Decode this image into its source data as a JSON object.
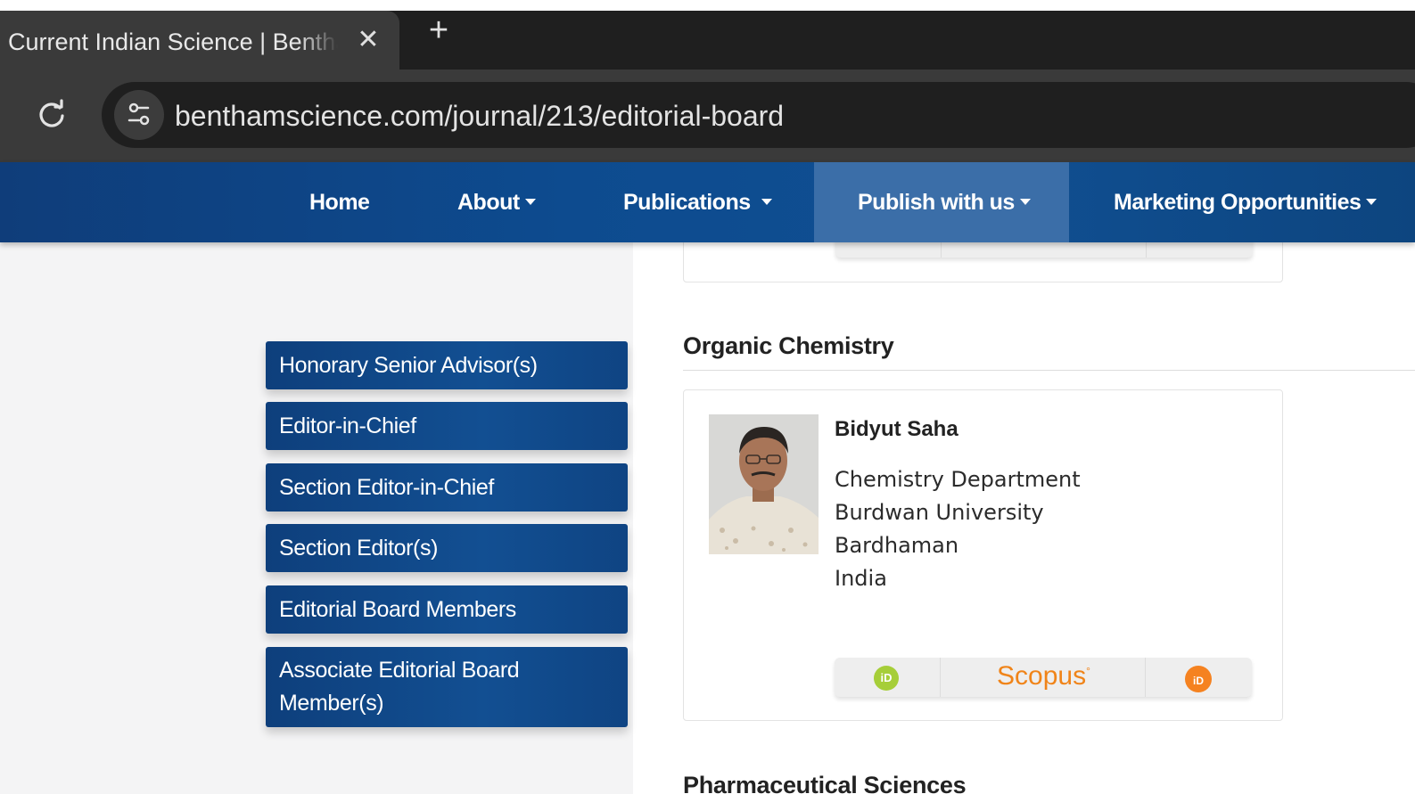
{
  "browser": {
    "tab_title": "Current Indian Science | Bentham Science",
    "close_glyph": "✕",
    "new_tab_glyph": "+",
    "url": "benthamscience.com/journal/213/editorial-board"
  },
  "nav": {
    "items": [
      {
        "label": "Home",
        "has_caret": false
      },
      {
        "label": "About",
        "has_caret": true
      },
      {
        "label": "Publications",
        "has_caret": true
      },
      {
        "label": "Publish with us",
        "has_caret": true,
        "active": true
      },
      {
        "label": "Marketing Opportunities",
        "has_caret": true
      }
    ]
  },
  "sidebar": {
    "items": [
      {
        "label": "Honorary Senior Advisor(s)"
      },
      {
        "label": "Editor-in-Chief"
      },
      {
        "label": "Section Editor-in-Chief"
      },
      {
        "label": "Section Editor(s)"
      },
      {
        "label": "Editorial Board Members"
      },
      {
        "label": "Associate Editorial Board Member(s)"
      }
    ]
  },
  "sections": [
    {
      "title": "Organic Chemistry",
      "member": {
        "name": "Bidyut Saha",
        "affiliation": [
          "Chemistry Department",
          "Burdwan University",
          "Bardhaman",
          "India"
        ]
      }
    },
    {
      "title": "Pharmaceutical Sciences"
    }
  ],
  "profile_links": {
    "orcid": "iD",
    "scopus": "Scopus",
    "publons": "iD"
  },
  "colors": {
    "nav_blue": "#0d4b8f",
    "nav_active": "#3b6ea8",
    "orcid_green": "#a6ce39",
    "scopus_orange": "#f08419",
    "publons_orange": "#f58220"
  }
}
